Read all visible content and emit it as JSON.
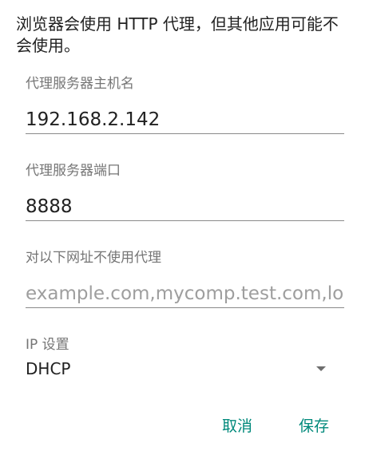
{
  "description": "浏览器会使用 HTTP 代理，但其他应用可能不会使用。",
  "proxy_host": {
    "label": "代理服务器主机名",
    "value": "192.168.2.142"
  },
  "proxy_port": {
    "label": "代理服务器端口",
    "value": "8888"
  },
  "bypass": {
    "label": "对以下网址不使用代理",
    "placeholder": "example.com,mycomp.test.com,localhost"
  },
  "ip_settings": {
    "label": "IP 设置",
    "value": "DHCP",
    "icon": "chevron-down-icon"
  },
  "actions": {
    "cancel": "取消",
    "save": "保存"
  },
  "colors": {
    "accent": "#00897b",
    "text": "#212121",
    "label": "#757575"
  }
}
